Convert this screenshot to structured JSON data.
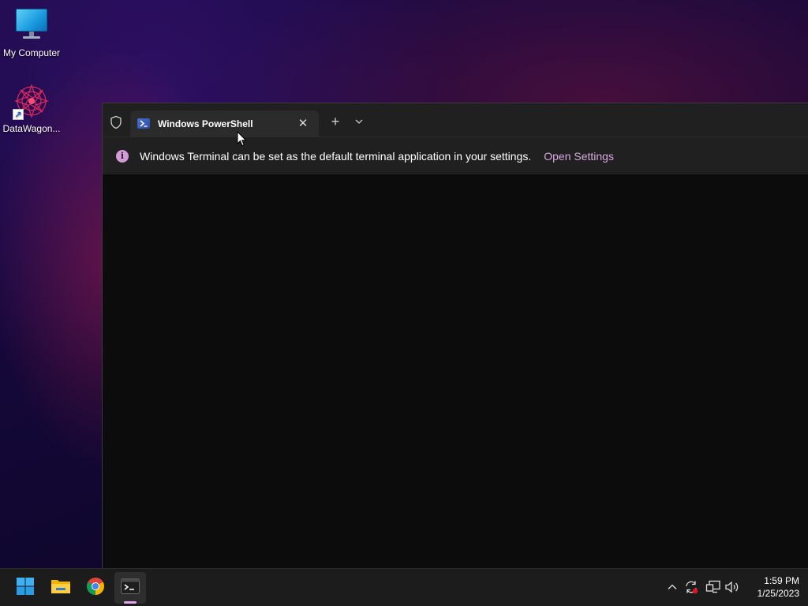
{
  "desktop": {
    "icons": [
      {
        "label": "My Computer"
      },
      {
        "label": "DataWagon..."
      }
    ]
  },
  "terminal": {
    "tab": {
      "title": "Windows PowerShell",
      "close_symbol": "✕"
    },
    "new_tab_symbol": "+",
    "infobar": {
      "message": "Windows Terminal can be set as the default terminal application in your settings.",
      "link": "Open Settings",
      "info_symbol": "i"
    }
  },
  "taskbar": {
    "apps": [
      {
        "name": "start",
        "icon": "windows-logo-icon"
      },
      {
        "name": "file-explorer",
        "icon": "folder-icon"
      },
      {
        "name": "chrome",
        "icon": "chrome-icon"
      },
      {
        "name": "terminal",
        "icon": "terminal-icon",
        "active": true
      }
    ],
    "tray": {
      "icons": [
        "chevron-up-icon",
        "sync-icon",
        "network-icon",
        "volume-icon"
      ],
      "time": "1:59 PM",
      "date": "1/25/2023"
    }
  },
  "colors": {
    "accent": "#e2a6e8",
    "terminal_bg": "#0c0c0c",
    "titlebar_bg": "#202020",
    "link": "#d8a8e0"
  }
}
